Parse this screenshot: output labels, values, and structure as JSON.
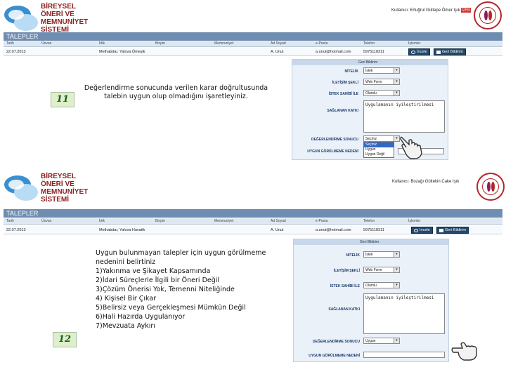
{
  "logo": {
    "lines": [
      "BİREYSEL",
      "ÖNERİ VE",
      "MEMNUNİYET",
      "SİSTEMİ"
    ]
  },
  "header": {
    "user_text_1": "Kullanıcı: Ertuğrul Gültepe Ömer Işık",
    "user_text_2": "Kullanıcı: Bozağı Gültekin Cake Işık",
    "logout": "Çıkış"
  },
  "section_title": "TALEPLER",
  "columns": [
    "Tarih",
    "Ünvan",
    "İrtik",
    "Birşim",
    "Memnuniyet",
    "Ad Soyad",
    "e-Posta",
    "Telefon",
    "İşlemler"
  ],
  "rows": [
    {
      "date": "22.07.2013",
      "unit": "Methabdar, Yalova Ömeşik",
      "name": "A. Unut",
      "email": "a.unut@hotmail.com",
      "phone": "5975118311"
    },
    {
      "date": "22.07.2013",
      "unit": "Methabdar, Yalova Havatik",
      "name": "A. Unut",
      "email": "a.unut@hotmail.com",
      "phone": "5975118311"
    }
  ],
  "buttons": {
    "inspect": "İncele",
    "feedback": "Geri Bildirim"
  },
  "form": {
    "header": "Geri Bildirim",
    "labels": {
      "nitelik": "NİTELİK",
      "iletisim": "İLETİŞİM ŞEKLİ",
      "istek_sahibi": "İSTEK SAHİBİ İLE",
      "saglanan_katki": "SAĞLANAN KATKI",
      "degerlendirme": "DEĞERLENDİRME SONUCU",
      "uygun_gorulmeme": "UYGUN GÖRÜLMEME NEDENİ"
    },
    "values_1": {
      "nitelik": "İstek",
      "iletisim": "Web Form",
      "istek_sahibi": "Olumlu",
      "katki": "Uygulamanın iyileştirilmesi",
      "degerlendirme": "Seçiniz"
    },
    "values_2": {
      "nitelik": "İstek",
      "iletisim": "Web Form",
      "istek_sahibi": "Olumlu",
      "katki": "Uygulamanın iyileştirilmesi",
      "degerlendirme": "Uygun"
    },
    "dropdown_options": [
      "Seçiniz",
      "Uygun",
      "Uygun Değil"
    ]
  },
  "callouts": {
    "step_11": "11",
    "step_12": "12",
    "text_11": "Değerlendirme sonucunda verilen karar doğrultusunda talebin uygun olup olmadığını işaretleyiniz.",
    "text_12_lines": [
      "Uygun bulunmayan talepler için uygun görülmeme",
      "nedenini belirtiniz",
      "1)Yakınma ve Şikayet Kapsamında",
      "2)İdari Süreçlerle İlgili bir Öneri Değil",
      "3)Çözüm Önerisi Yok, Temenni Niteliğinde",
      "4) Kişisel Bir Çıkar",
      "5)Belirsiz veya Gerçekleşmesi Mümkün Değil",
      "6)Hali Hazırda Uygulanıyor",
      "7)Mevzuata Aykırı"
    ]
  },
  "colors": {
    "title_bar": "#6f8db0",
    "button": "#23486a",
    "brand_red": "#8b1e1e",
    "callout_bg": "#dfeecb"
  }
}
